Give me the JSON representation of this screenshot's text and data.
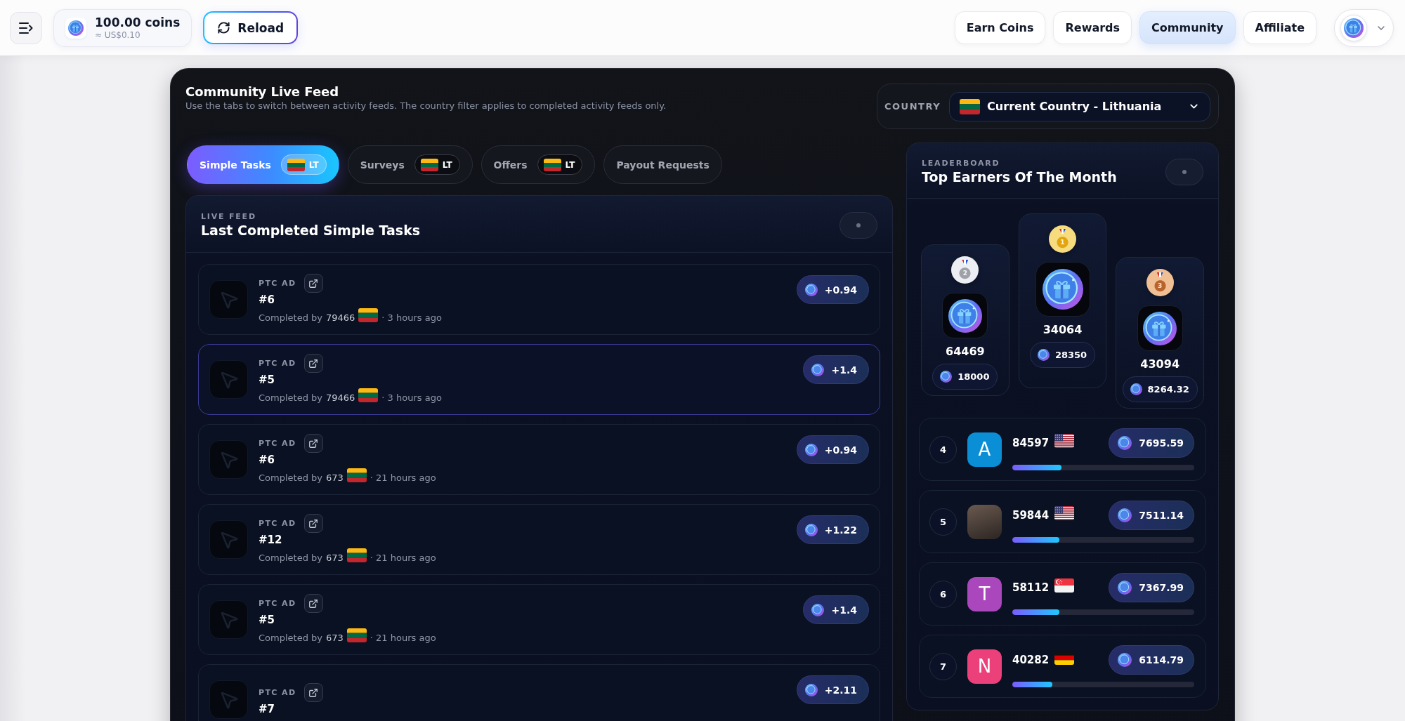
{
  "top_bar": {
    "balance": {
      "amount": "100.00 coins",
      "usd": "≈ US$0.10"
    },
    "reload_button": "Reload",
    "nav": [
      {
        "label": "Earn Coins",
        "selected": false
      },
      {
        "label": "Rewards",
        "selected": false
      },
      {
        "label": "Community",
        "selected": true
      },
      {
        "label": "Affiliate",
        "selected": false
      }
    ]
  },
  "community": {
    "title": "Community Live Feed",
    "subtitle": "Use the tabs to switch between activity feeds. The country filter applies to completed activity feeds only.",
    "country_filter": {
      "label": "COUNTRY",
      "value": "Current Country - Lithuania",
      "flag": {
        "kind": "lithuania"
      }
    },
    "tabs": [
      {
        "label": "Simple Tasks",
        "selected": true,
        "badge": {
          "code": "LT",
          "flag": {
            "kind": "lithuania"
          }
        }
      },
      {
        "label": "Surveys",
        "selected": false,
        "badge": {
          "code": "LT",
          "flag": {
            "kind": "lithuania"
          }
        }
      },
      {
        "label": "Offers",
        "selected": false,
        "badge": {
          "code": "LT",
          "flag": {
            "kind": "lithuania"
          }
        }
      },
      {
        "label": "Payout Requests",
        "selected": false
      }
    ],
    "live_feed": {
      "eyebrow": "LIVE FEED",
      "title": "Last Completed Simple Tasks",
      "items": [
        {
          "type": "PTC AD",
          "title": "#6",
          "completed_label": "Completed by",
          "user": "79466",
          "flag": {
            "kind": "lithuania"
          },
          "time": "· 3 hours ago",
          "reward": "+0.94",
          "highlighted": false
        },
        {
          "type": "PTC AD",
          "title": "#5",
          "completed_label": "Completed by",
          "user": "79466",
          "flag": {
            "kind": "lithuania"
          },
          "time": "· 3 hours ago",
          "reward": "+1.4",
          "highlighted": true
        },
        {
          "type": "PTC AD",
          "title": "#6",
          "completed_label": "Completed by",
          "user": "673",
          "flag": {
            "kind": "lithuania"
          },
          "time": "· 21 hours ago",
          "reward": "+0.94",
          "highlighted": false
        },
        {
          "type": "PTC AD",
          "title": "#12",
          "completed_label": "Completed by",
          "user": "673",
          "flag": {
            "kind": "lithuania"
          },
          "time": "· 21 hours ago",
          "reward": "+1.22",
          "highlighted": false
        },
        {
          "type": "PTC AD",
          "title": "#5",
          "completed_label": "Completed by",
          "user": "673",
          "flag": {
            "kind": "lithuania"
          },
          "time": "· 21 hours ago",
          "reward": "+1.4",
          "highlighted": false
        },
        {
          "type": "PTC AD",
          "title": "#7",
          "reward": "+2.11",
          "highlighted": false
        }
      ]
    },
    "leaderboard": {
      "eyebrow": "LEADERBOARD",
      "title": "Top Earners Of The Month",
      "podium": [
        {
          "kind": "silver",
          "rank": "2",
          "user": "64469",
          "amount": "18000"
        },
        {
          "kind": "gold",
          "rank": "1",
          "user": "34064",
          "amount": "28350"
        },
        {
          "kind": "bronze",
          "rank": "3",
          "user": "43094",
          "amount": "8264.32"
        }
      ],
      "ranking": [
        {
          "rank": "4",
          "avatar": {
            "kind": "initial",
            "letter": "A",
            "color": "#0a8fd6"
          },
          "user": "84597",
          "flag": {
            "kind": "united_states"
          },
          "amount": "7695.59",
          "level": 0.27
        },
        {
          "rank": "5",
          "avatar": {
            "kind": "photo"
          },
          "user": "59844",
          "flag": {
            "kind": "united_states"
          },
          "amount": "7511.14",
          "level": 0.26
        },
        {
          "rank": "6",
          "avatar": {
            "kind": "initial",
            "letter": "T",
            "color": "#ab47bc"
          },
          "user": "58112",
          "flag": {
            "kind": "singapore"
          },
          "amount": "7367.99",
          "level": 0.26
        },
        {
          "rank": "7",
          "avatar": {
            "kind": "initial",
            "letter": "N",
            "color": "#ec407a"
          },
          "user": "40282",
          "flag": {
            "kind": "germany"
          },
          "amount": "6114.79",
          "level": 0.22
        }
      ]
    }
  }
}
